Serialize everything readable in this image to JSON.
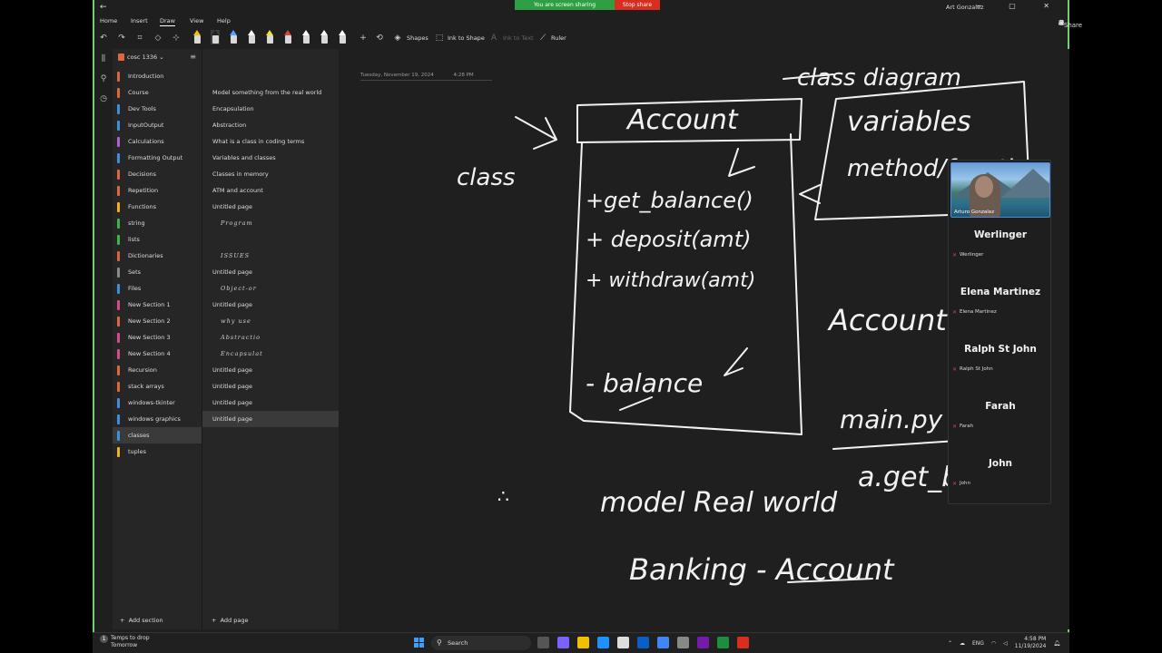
{
  "window": {
    "back": "←",
    "user_name": "Art Gonzalez",
    "controls": "─ ▢ ✕"
  },
  "share_banner": {
    "sharing_text": "You are screen sharing",
    "stop_text": "Stop share"
  },
  "menu": {
    "tabs": [
      "Home",
      "Insert",
      "Draw",
      "View",
      "Help"
    ],
    "active_tab": "Draw",
    "share_label": "Share"
  },
  "toolbar": {
    "shapes_label": "Shapes",
    "ink_to_shape_label": "Ink to Shape",
    "ink_to_text_label": "Ink to Text",
    "ruler_label": "Ruler",
    "pen_colors": [
      "#f2c000",
      "#222222",
      "#5aa0ff",
      "#ffffff",
      "#f0e030",
      "#e04040",
      "#ffffff",
      "#ffffff",
      "#ffffff"
    ]
  },
  "notebook": {
    "title": "cosc 1336",
    "sections": [
      {
        "label": "Introduction",
        "color": "#d9663c"
      },
      {
        "label": "Course",
        "color": "#e0663c"
      },
      {
        "label": "Dev Tools",
        "color": "#3d8fd9"
      },
      {
        "label": "InputOutput",
        "color": "#3d8fd9"
      },
      {
        "label": "Calculations",
        "color": "#b35cd6"
      },
      {
        "label": "Formatting Output",
        "color": "#3d8fd9"
      },
      {
        "label": "Decisions",
        "color": "#e0663c"
      },
      {
        "label": "Repetition",
        "color": "#e0663c"
      },
      {
        "label": "Functions",
        "color": "#f2b01e"
      },
      {
        "label": "string",
        "color": "#3cb54a"
      },
      {
        "label": "lists",
        "color": "#3cb54a"
      },
      {
        "label": "Dictionaries",
        "color": "#d9663c"
      },
      {
        "label": "Sets",
        "color": "#8a8a8a"
      },
      {
        "label": "Files",
        "color": "#3d8fd9"
      },
      {
        "label": "New Section 1",
        "color": "#d94a8c"
      },
      {
        "label": "New Section 2",
        "color": "#e0663c"
      },
      {
        "label": "New Section 3",
        "color": "#d94a8c"
      },
      {
        "label": "New Section 4",
        "color": "#d94a8c"
      },
      {
        "label": "Recursion",
        "color": "#e0663c"
      },
      {
        "label": "stack arrays",
        "color": "#e0663c"
      },
      {
        "label": "windows-tkinter",
        "color": "#3d8fd9"
      },
      {
        "label": "windows graphics",
        "color": "#3d8fd9"
      },
      {
        "label": "classes",
        "color": "#3d8fd9"
      },
      {
        "label": "tuples",
        "color": "#f2b01e"
      }
    ],
    "selected_section": "classes",
    "add_section_label": "Add section"
  },
  "pages": {
    "items": [
      {
        "label": "Model something from the real world",
        "hand": false
      },
      {
        "label": "Encapsulation",
        "hand": false
      },
      {
        "label": "Abstraction",
        "hand": false
      },
      {
        "label": "What is a class in coding terms",
        "hand": false
      },
      {
        "label": "Variables and classes",
        "hand": false
      },
      {
        "label": "Classes in memory",
        "hand": false
      },
      {
        "label": "ATM and account",
        "hand": false
      },
      {
        "label": "Untitled page",
        "hand": false
      },
      {
        "label": "Program",
        "hand": true
      },
      {
        "label": "",
        "hand": false
      },
      {
        "label": "ISSUES",
        "hand": true
      },
      {
        "label": "Untitled page",
        "hand": false
      },
      {
        "label": "Object-or",
        "hand": true
      },
      {
        "label": "Untitled page",
        "hand": false
      },
      {
        "label": "why use",
        "hand": true
      },
      {
        "label": "Abstractio",
        "hand": true
      },
      {
        "label": "Encapsulat",
        "hand": true
      },
      {
        "label": "Untitled page",
        "hand": false
      },
      {
        "label": "Untitled page",
        "hand": false
      },
      {
        "label": "Untitled page",
        "hand": false
      },
      {
        "label": "Untitled page",
        "hand": false
      }
    ],
    "selected_index": 20,
    "add_page_label": "Add page"
  },
  "canvas": {
    "date": "Tuesday, November 19, 2024",
    "time": "4:28 PM",
    "ink_text": {
      "class_diagram": "class diagram",
      "class_label": "class",
      "account_title": "Account",
      "get_balance": "+get_balance()",
      "deposit": "+ deposit(amt)",
      "withdraw": "+ withdraw(amt)",
      "balance": "- balance",
      "variables": "variables",
      "method_function": "method/functio",
      "account_a": "Account a;",
      "main_py": "main.py",
      "a_get_bal": "a.get_bala",
      "model_real_world": "model Real world",
      "banking": "Banking - Account"
    }
  },
  "participants": {
    "video_name": "Arturo Gonzalez",
    "people": [
      {
        "name": "Werlinger",
        "sub": "Werlinger"
      },
      {
        "name": "Elena Martinez",
        "sub": "Elena Martinez"
      },
      {
        "name": "Ralph St John",
        "sub": "Ralph St John"
      },
      {
        "name": "Farah",
        "sub": "Farah"
      },
      {
        "name": "John",
        "sub": "John"
      }
    ]
  },
  "taskbar": {
    "weather_title": "Temps to drop",
    "weather_sub": "Tomorrow",
    "search_placeholder": "Search",
    "lang": "ENG",
    "time": "4:58 PM",
    "date": "11/19/2024"
  }
}
